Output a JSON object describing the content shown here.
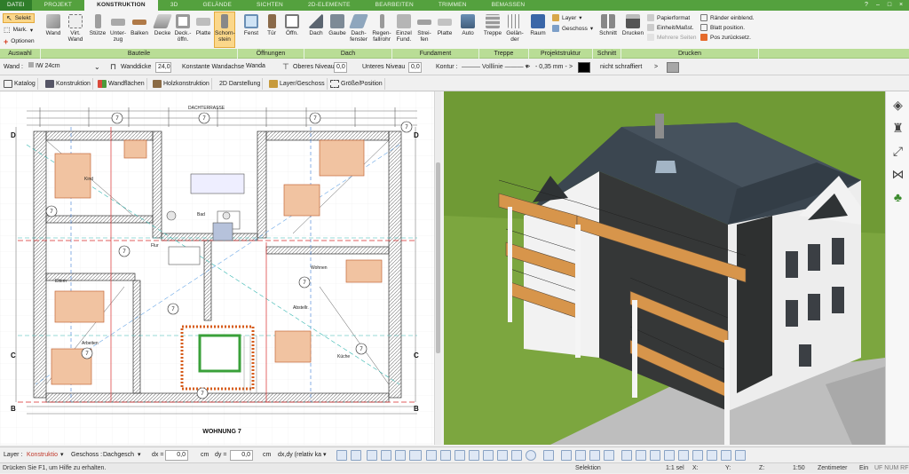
{
  "tabs": [
    "DATEI",
    "PROJEKT",
    "KONSTRUKTION",
    "3D",
    "GELÄNDE",
    "SICHTEN",
    "2D-ELEMENTE",
    "BEARBEITEN",
    "TRIMMEN",
    "BEMASSEN"
  ],
  "window_buttons": [
    "?",
    "–",
    "□",
    "×"
  ],
  "ribbon": {
    "auswahl": {
      "select": "Selekt",
      "mark": "Mark.",
      "options": "Optionen"
    },
    "bauteile": [
      "Wand",
      "Virt. Wand",
      "Stütze",
      "Unter- zug",
      "Balken",
      "Decke",
      "Deck.- öffn.",
      "Platte",
      "Schorn- stein"
    ],
    "oeffnungen": [
      "Fenst",
      "Tür",
      "Öffn."
    ],
    "dach": [
      "Dach",
      "Gaube",
      "Dach- fenster",
      "Regen- fallrohr"
    ],
    "fundament": [
      "Einzel Fund.",
      "Strei- fen",
      "Platte"
    ],
    "auto": "Auto",
    "treppe": [
      "Treppe",
      "Gelän- der"
    ],
    "raum": "Raum",
    "projektstruktur": {
      "layer": "Layer",
      "geschoss": "Geschoss"
    },
    "schnitt": "Schnitt",
    "drucken": {
      "drucken": "Drucken",
      "papierformat": "Papierformat",
      "einheit": "Einheit/Maßst.",
      "mehrere": "Mehrere Seiten",
      "raender": "Ränder einblend.",
      "blatt": "Blatt position.",
      "pos": "Pos zurücksetz."
    }
  },
  "groups": [
    "Auswahl",
    "Bauteile",
    "Öffnungen",
    "Dach",
    "Fundament",
    "Treppe",
    "Projektstruktur",
    "Schnitt",
    "Drucken"
  ],
  "properties": {
    "wand_label": "Wand :",
    "wand_value": "IW 24cm",
    "dicke_label": "Wanddicke",
    "dicke_value": "24,0",
    "konstante": "Konstante Wandachse",
    "wandachse": "Wanda",
    "oberes_label": "Oberes Niveau",
    "oberes_value": "0,0",
    "unteres_label": "Unteres Niveau",
    "unteres_value": "0,0",
    "kontur_label": "Kontur :",
    "linie": "Volllinie",
    "breite": "- 0,35 mm -",
    "schraffur": "nicht schraffiert"
  },
  "toolbar2": [
    "Katalog",
    "Konstruktion",
    "Wandflächen",
    "Holzkonstruktion",
    "2D Darstellung",
    "Layer/Geschoss",
    "Größe/Position"
  ],
  "plan": {
    "room_number": "7",
    "title": "WOHNUNG 7",
    "dachterrasse": "DACHTERRASSE",
    "rooms": [
      "Kind",
      "Flur",
      "Bad",
      "Eltern",
      "Arbeiten",
      "Wohnen",
      "Abstellr.",
      "Küche"
    ],
    "section_marks": [
      "D",
      "D",
      "C",
      "C",
      "B",
      "B"
    ]
  },
  "bottom": {
    "layer_label": "Layer :",
    "layer_value": "Konstruktio",
    "geschoss_label": "Geschoss :",
    "geschoss_value": "Dachgesch",
    "dx_label": "dx =",
    "dx_value": "0,0",
    "dy_label": "dy =",
    "dy_value": "0,0",
    "unit": "cm",
    "relativ": "dx,dy (relativ ka"
  },
  "status": {
    "help": "Drücken Sie F1, um Hilfe zu erhalten.",
    "mode": "Selektion",
    "scale": "1:1 sel",
    "x": "X:",
    "y": "Y:",
    "z": "Z:",
    "ratio": "1:50",
    "unit": "Zentimeter",
    "ein": "Ein",
    "flags": "UF NUM RF"
  },
  "colors": {
    "accent": "#54a13e",
    "group_bar": "#b9dd96",
    "active": "#fbd78a",
    "roof": "#3b4650",
    "wall_dark": "#2e3030",
    "balcony": "#d7954b",
    "grass": "#79a83c"
  }
}
